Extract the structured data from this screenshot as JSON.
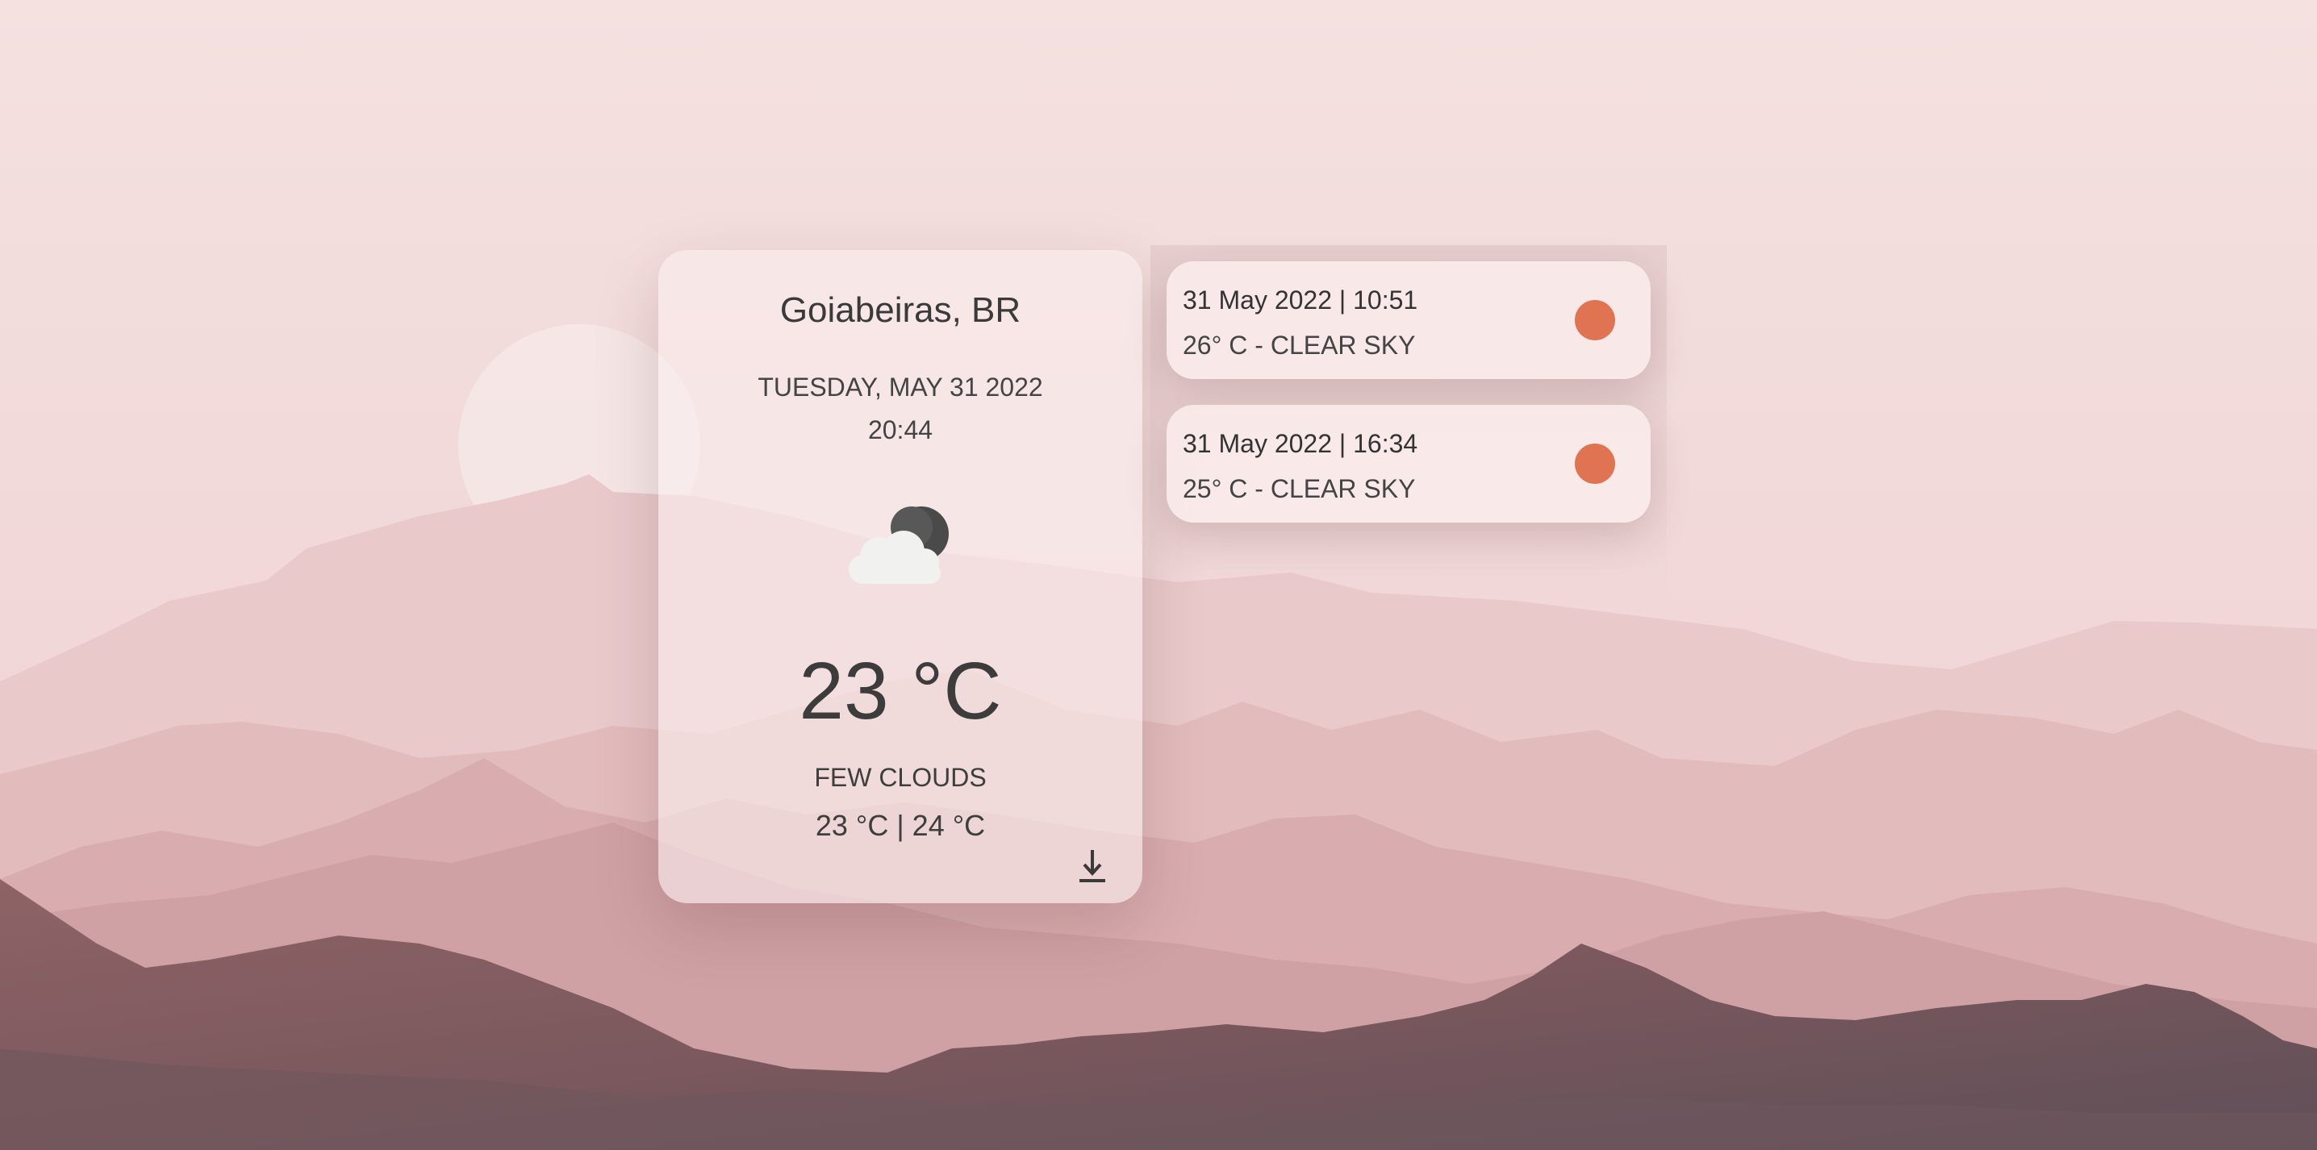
{
  "current": {
    "location": "Goiabeiras, BR",
    "date": "TUESDAY, MAY 31 2022",
    "time": "20:44",
    "temperature": "23 °C",
    "description": "FEW CLOUDS",
    "min_max": "23 °C | 24 °C",
    "icon": "few-clouds-night-icon",
    "download_icon": "download-icon"
  },
  "history": [
    {
      "title": "31 May 2022 | 10:51",
      "summary": "26° C - CLEAR SKY",
      "dot_color": "#e07452"
    },
    {
      "title": "31 May 2022 | 16:34",
      "summary": "25° C - CLEAR SKY",
      "dot_color": "#e07452"
    }
  ],
  "colors": {
    "sky_top": "#f4e1e0",
    "sky_bottom": "#efd0d1",
    "accent_dot": "#e07452",
    "text": "#3f3f3f"
  }
}
